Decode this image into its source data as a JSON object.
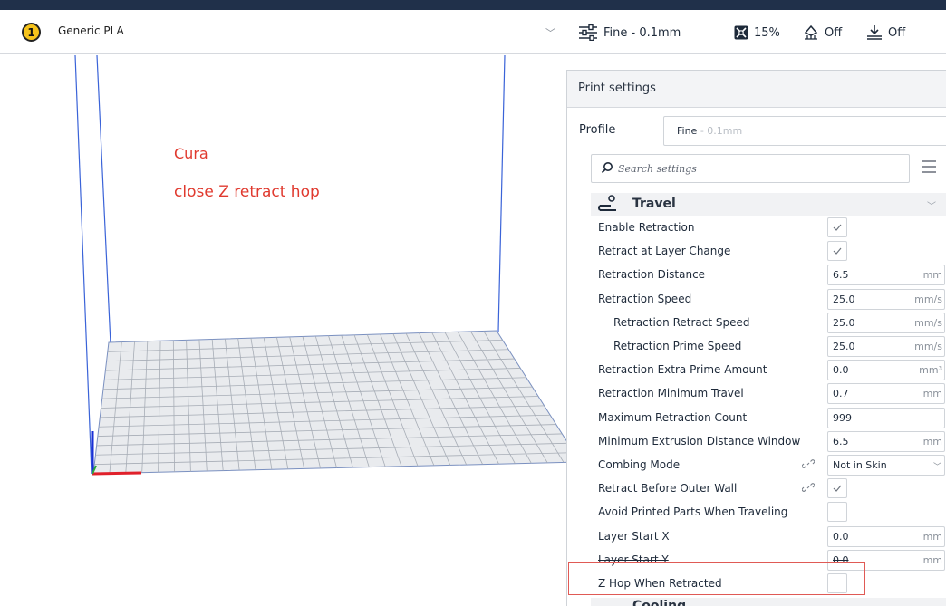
{
  "material": {
    "extruder": "1",
    "name": "Generic PLA"
  },
  "quick_settings": {
    "profile": "Fine - 0.1mm",
    "infill": "15%",
    "support": "Off",
    "adhesion": "Off"
  },
  "annotation": {
    "line1": "Cura",
    "line2": "close Z  retract hop"
  },
  "panel": {
    "title": "Print settings",
    "profile_label": "Profile",
    "profile_name": "Fine",
    "profile_sub": " - 0.1mm",
    "search_placeholder": "Search settings",
    "category": "Travel",
    "next_category": "Cooling",
    "settings": [
      {
        "label": "Enable Retraction",
        "type": "check",
        "checked": true
      },
      {
        "label": "Retract at Layer Change",
        "type": "check",
        "checked": true
      },
      {
        "label": "Retraction Distance",
        "type": "input",
        "value": "6.5",
        "unit": "mm"
      },
      {
        "label": "Retraction Speed",
        "type": "input",
        "value": "25.0",
        "unit": "mm/s"
      },
      {
        "label": "Retraction Retract Speed",
        "type": "input",
        "value": "25.0",
        "unit": "mm/s",
        "indent": true
      },
      {
        "label": "Retraction Prime Speed",
        "type": "input",
        "value": "25.0",
        "unit": "mm/s",
        "indent": true
      },
      {
        "label": "Retraction Extra Prime Amount",
        "type": "input",
        "value": "0.0",
        "unit": "mm³"
      },
      {
        "label": "Retraction Minimum Travel",
        "type": "input",
        "value": "0.7",
        "unit": "mm"
      },
      {
        "label": "Maximum Retraction Count",
        "type": "input",
        "value": "999",
        "unit": ""
      },
      {
        "label": "Minimum Extrusion Distance Window",
        "type": "input",
        "value": "6.5",
        "unit": "mm"
      },
      {
        "label": "Combing Mode",
        "type": "select",
        "value": "Not in Skin",
        "linked": true
      },
      {
        "label": "Retract Before Outer Wall",
        "type": "check",
        "checked": true,
        "linked": true
      },
      {
        "label": "Avoid Printed Parts When Traveling",
        "type": "check",
        "checked": false
      },
      {
        "label": "Layer Start X",
        "type": "input",
        "value": "0.0",
        "unit": "mm"
      },
      {
        "label": "Layer Start Y",
        "type": "input",
        "value": "0.0",
        "unit": "mm",
        "strike": true
      },
      {
        "label": "Z Hop When Retracted",
        "type": "check",
        "checked": false,
        "highlight": true
      }
    ]
  },
  "colors": {
    "accent": "#196ef0",
    "annotation": "#e03a2f",
    "highlight_box": "#e05a55"
  }
}
